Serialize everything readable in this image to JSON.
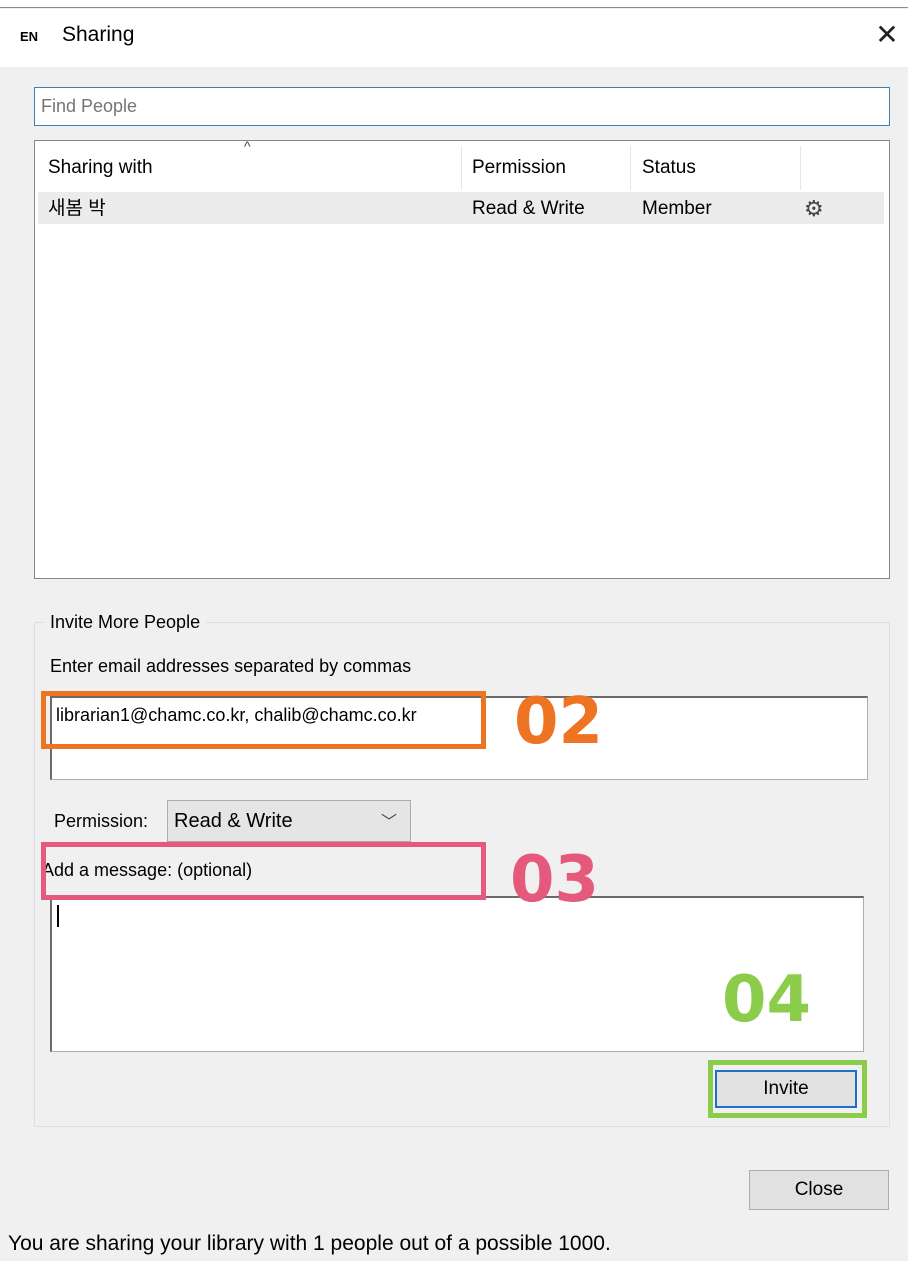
{
  "window": {
    "app_icon": "EN",
    "title": "Sharing",
    "close_glyph": "✕"
  },
  "search": {
    "placeholder": "Find People",
    "value": ""
  },
  "table": {
    "sort_indicator": "^",
    "columns": [
      "Sharing with",
      "Permission",
      "Status",
      ""
    ],
    "rows": [
      {
        "name": "새봄 박",
        "permission": "Read & Write",
        "status": "Member",
        "action_icon": "gear-icon"
      }
    ]
  },
  "invite": {
    "group_label": "Invite More People",
    "email_label": "Enter email addresses separated by commas",
    "email_value": "librarian1@chamc.co.kr, chalib@chamc.co.kr",
    "permission_label": "Permission:",
    "permission_value": "Read & Write",
    "message_label": "Add a message: (optional)",
    "message_value": "",
    "invite_button": "Invite"
  },
  "footer": {
    "close_button": "Close",
    "status": "You are sharing your library with 1 people out of a possible 1000."
  },
  "annotations": [
    {
      "label": "02",
      "color": "#ed7423"
    },
    {
      "label": "03",
      "color": "#e55a7c"
    },
    {
      "label": "04",
      "color": "#8bcc4b"
    }
  ]
}
